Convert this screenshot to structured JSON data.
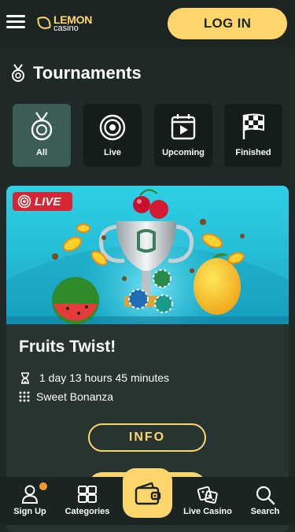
{
  "header": {
    "logo_line1": "LEMON",
    "logo_line2": "casino",
    "login_label": "LOG IN"
  },
  "page": {
    "title": "Tournaments"
  },
  "filters": [
    {
      "label": "All",
      "icon": "medal-icon",
      "active": true
    },
    {
      "label": "Live",
      "icon": "target-icon",
      "active": false
    },
    {
      "label": "Upcoming",
      "icon": "calendar-play-icon",
      "active": false
    },
    {
      "label": "Finished",
      "icon": "checkered-flag-icon",
      "active": false
    }
  ],
  "tournament": {
    "badge": "LIVE",
    "name": "Fruits Twist!",
    "time_left": "1 day 13 hours 45 minutes",
    "game": "Sweet Bonanza",
    "info_label": "INFO"
  },
  "bottom_nav": [
    {
      "label": "Sign Up",
      "icon": "user-icon"
    },
    {
      "label": "Categories",
      "icon": "grid-icon"
    },
    {
      "label": "",
      "icon": "wallet-icon"
    },
    {
      "label": "Live Casino",
      "icon": "dice-icon"
    },
    {
      "label": "Search",
      "icon": "search-icon"
    }
  ],
  "colors": {
    "accent": "#ffd66b",
    "live": "#d52634",
    "background": "#1f2a28"
  }
}
